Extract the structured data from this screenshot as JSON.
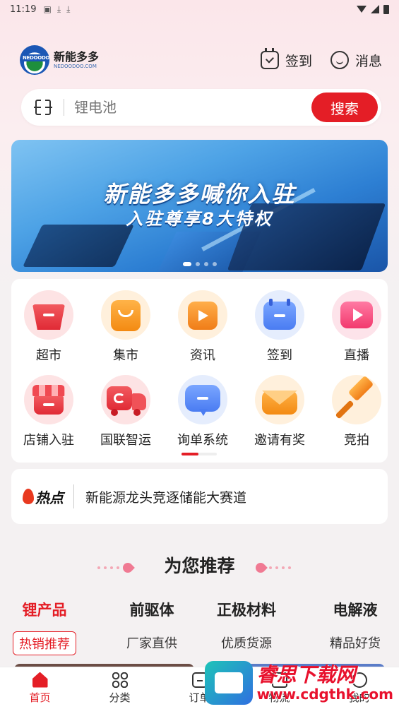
{
  "status_bar": {
    "time": "11:19"
  },
  "header": {
    "logo_cn": "新能多多",
    "logo_en": "NEDOODOO.COM",
    "logo_mark_text": "NEDOODOO",
    "checkin_label": "签到",
    "message_label": "消息"
  },
  "search": {
    "placeholder": "锂电池",
    "button_label": "搜索"
  },
  "banner": {
    "line1": "新能多多喊你入驻",
    "line2": "入驻尊享8大特权",
    "slide_count": 4,
    "active_slide": 1
  },
  "quick_entries": [
    {
      "label": "超市",
      "icon": "basket-icon"
    },
    {
      "label": "集市",
      "icon": "shopping-bag-icon"
    },
    {
      "label": "资讯",
      "icon": "news-icon"
    },
    {
      "label": "签到",
      "icon": "calendar-icon"
    },
    {
      "label": "直播",
      "icon": "live-play-icon"
    },
    {
      "label": "店铺入驻",
      "icon": "storefront-icon"
    },
    {
      "label": "国联智运",
      "icon": "delivery-truck-icon"
    },
    {
      "label": "询单系统",
      "icon": "chat-bubble-icon"
    },
    {
      "label": "邀请有奖",
      "icon": "envelope-icon"
    },
    {
      "label": "竞拍",
      "icon": "auction-hammer-icon"
    }
  ],
  "hot_news": {
    "badge": "热点",
    "text": "新能源龙头竞逐储能大赛道"
  },
  "recommend": {
    "title": "为您推荐",
    "categories": [
      {
        "name": "锂产品",
        "sub": "热销推荐",
        "active": true
      },
      {
        "name": "前驱体",
        "sub": "厂家直供",
        "active": false
      },
      {
        "name": "正极材料",
        "sub": "优质货源",
        "active": false
      },
      {
        "name": "电解液",
        "sub": "精品好货",
        "active": false
      }
    ]
  },
  "tabbar": [
    {
      "label": "首页",
      "active": true
    },
    {
      "label": "分类",
      "active": false
    },
    {
      "label": "订单",
      "active": false
    },
    {
      "label": "物流",
      "active": false
    },
    {
      "label": "我的",
      "active": false
    }
  ],
  "watermark": {
    "cn": "睿思下载网",
    "en": "www.cdgthk.com"
  },
  "colors": {
    "brand_red": "#e41e26",
    "page_bg": "#f4f1f2"
  }
}
